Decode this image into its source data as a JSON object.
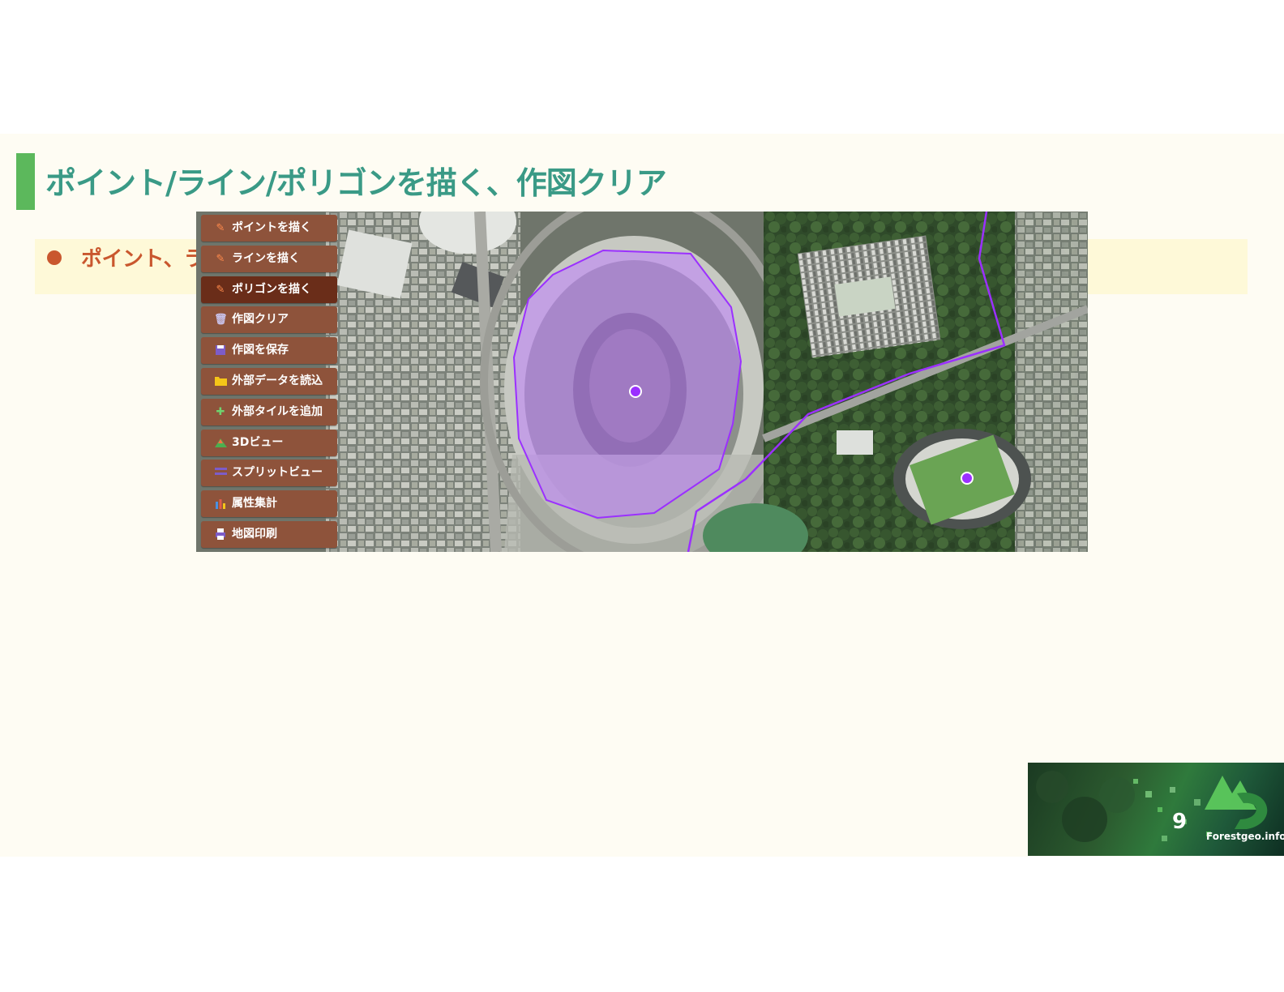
{
  "slide": {
    "title": "ポイント/ライン/ポリゴンを描く、作図クリア",
    "bullet": "ポイント、ライン、ポリゴンいずれも作図することができます。"
  },
  "toolbar": {
    "items": [
      {
        "label": "ポイントを描く",
        "icon": "pencil-icon"
      },
      {
        "label": "ラインを描く",
        "icon": "pencil-icon"
      },
      {
        "label": "ポリゴンを描く",
        "icon": "pencil-icon"
      },
      {
        "label": "作図クリア",
        "icon": "trash-icon"
      },
      {
        "label": "作図を保存",
        "icon": "floppy-icon"
      },
      {
        "label": "外部データを読込",
        "icon": "folder-icon"
      },
      {
        "label": "外部タイルを追加",
        "icon": "puzzle-icon"
      },
      {
        "label": "3Dビュー",
        "icon": "mountain-icon"
      },
      {
        "label": "スプリットビュー",
        "icon": "split-icon"
      },
      {
        "label": "属性集計",
        "icon": "bar-chart-icon"
      },
      {
        "label": "地図印刷",
        "icon": "printer-icon"
      }
    ],
    "active_index": 2
  },
  "footer": {
    "page_number": "9",
    "brand": "Forestgeo.info"
  },
  "colors": {
    "title": "#3a9a86",
    "accent_bar": "#5cb85c",
    "bullet": "#c9572e",
    "menu_bg": "#8e533b",
    "menu_active": "#6a2d19",
    "drawing": "#9b30ff"
  }
}
